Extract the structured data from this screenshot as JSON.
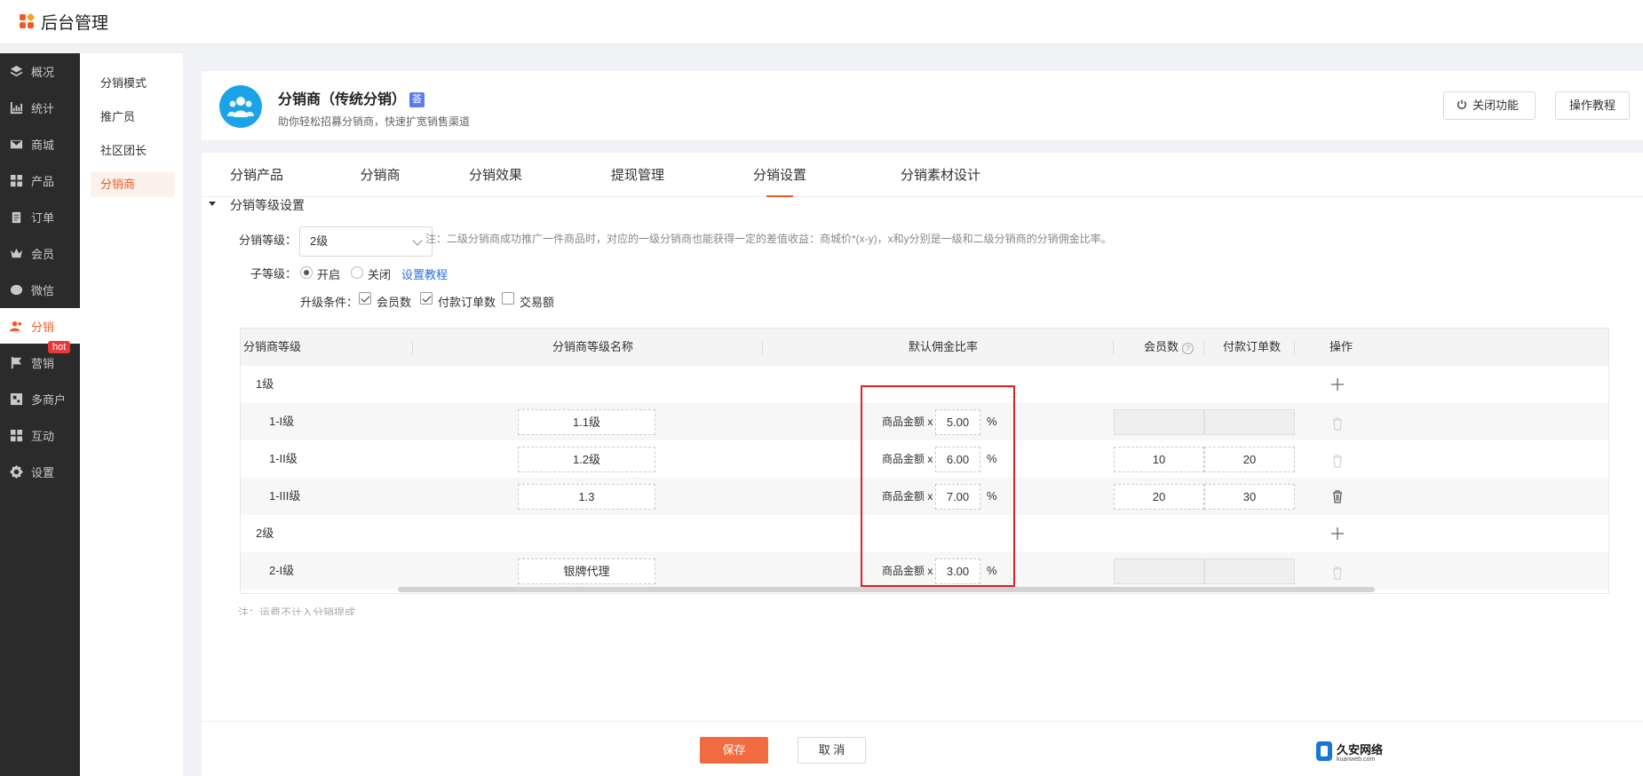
{
  "app": {
    "brand": "后台管理"
  },
  "sidebar": {
    "items": [
      {
        "label": "概况",
        "icon": "layers-icon"
      },
      {
        "label": "统计",
        "icon": "chart-icon"
      },
      {
        "label": "商城",
        "icon": "mail-icon"
      },
      {
        "label": "产品",
        "icon": "grid-icon"
      },
      {
        "label": "订单",
        "icon": "clipboard-icon"
      },
      {
        "label": "会员",
        "icon": "crown-icon"
      },
      {
        "label": "微信",
        "icon": "wechat-icon"
      },
      {
        "label": "分销",
        "icon": "people-icon",
        "active": true
      },
      {
        "label": "营销",
        "icon": "flag-icon",
        "badge": "hot"
      },
      {
        "label": "多商户",
        "icon": "store-icon"
      },
      {
        "label": "互动",
        "icon": "blocks-icon"
      },
      {
        "label": "设置",
        "icon": "gear-icon"
      }
    ]
  },
  "submenu": {
    "items": [
      {
        "label": "分销模式"
      },
      {
        "label": "推广员"
      },
      {
        "label": "社区团长"
      },
      {
        "label": "分销商",
        "active": true
      }
    ]
  },
  "header": {
    "title": "分销商（传统分销）",
    "tag": "荟",
    "subtitle": "助你轻松招募分销商，快速扩宽销售渠道",
    "close_btn": "关闭功能",
    "guide_btn": "操作教程"
  },
  "tabs": [
    {
      "label": "分销产品"
    },
    {
      "label": "分销商"
    },
    {
      "label": "分销效果"
    },
    {
      "label": "提现管理"
    },
    {
      "label": "分销设置",
      "active": true
    },
    {
      "label": "分销素材设计"
    }
  ],
  "settings": {
    "section_title": "分销等级设置",
    "level_label": "分销等级：",
    "level_value": "2级",
    "level_note": "注：二级分销商成功推广一件商品时，对应的一级分销商也能获得一定的差值收益：商城价*(x-y)，x和y分别是一级和二级分销商的分销佣金比率。",
    "sublevel_label": "子等级：",
    "radio_on": "开启",
    "radio_off": "关闭",
    "setup_link": "设置教程",
    "upgrade_label": "升级条件：",
    "cond_members": "会员数",
    "cond_orders": "付款订单数",
    "cond_amount": "交易额"
  },
  "table": {
    "headers": {
      "level": "分销商等级",
      "name": "分销商等级名称",
      "rate": "默认佣金比率",
      "members": "会员数",
      "orders": "付款订单数",
      "action": "操作"
    },
    "help_glyph": "?",
    "group1": "1级",
    "group2": "2级",
    "rate_prefix": "商品金额 x",
    "pct": "%",
    "rows": [
      {
        "level": "1-I级",
        "name": "1.1级",
        "rate": "5.00",
        "members": "",
        "orders": ""
      },
      {
        "level": "1-II级",
        "name": "1.2级",
        "rate": "6.00",
        "members": "10",
        "orders": "20"
      },
      {
        "level": "1-III级",
        "name": "1.3",
        "rate": "7.00",
        "members": "20",
        "orders": "30"
      },
      {
        "level": "2-I级",
        "name": "银牌代理",
        "rate": "3.00",
        "members": "",
        "orders": ""
      }
    ]
  },
  "footer": {
    "note": "注：运费不计入分销提成",
    "save": "保存",
    "cancel": "取 消"
  },
  "watermark": {
    "name": "久安网络",
    "url": "kuanweb.com"
  },
  "colors": {
    "accent": "#f05a28",
    "sidebar_bg": "#2b2b2b",
    "highlight_box": "#e81c24",
    "link": "#2f6fe0"
  }
}
